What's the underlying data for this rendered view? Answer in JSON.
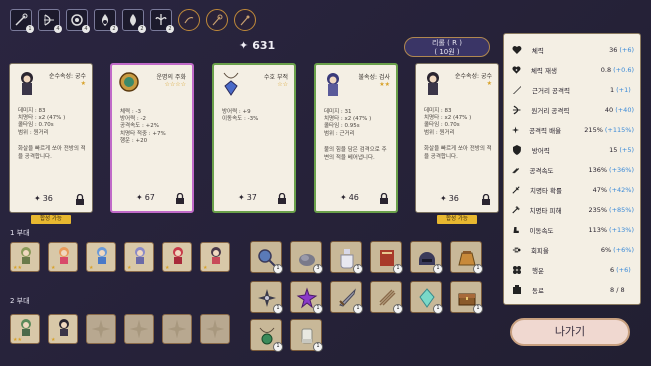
{
  "gold": "631",
  "reroll": {
    "line1": "리롤 ( R )",
    "line2": "( 10원 )"
  },
  "skills": [
    {
      "icon": "wand-icon",
      "lvl": "1"
    },
    {
      "icon": "bow-icon",
      "lvl": "4"
    },
    {
      "icon": "orb-icon",
      "lvl": "4"
    },
    {
      "icon": "fire-icon",
      "lvl": "2"
    },
    {
      "icon": "flame-icon",
      "lvl": "2"
    },
    {
      "icon": "leaf-icon",
      "lvl": "2"
    },
    {
      "icon": "wind-icon",
      "lvl": ""
    },
    {
      "icon": "staff-icon",
      "lvl": ""
    },
    {
      "icon": "rod-icon",
      "lvl": ""
    }
  ],
  "cards": [
    {
      "title": "순수속성: 궁수",
      "stars": "★",
      "stats": "데미지 : 83\n치명타 : x2 (47% )\n쿨타임 : 0.70s\n범위 : 원거리",
      "desc": "화살을 빠르게 쏘아 전방의 적을 공격합니다.",
      "price": "36"
    },
    {
      "title": "운명의 주화",
      "stars": "☆☆☆☆",
      "stats": "체력 : -3\n방어력 : -2\n공격속도 : +2%\n치명타 적중 : +7%\n행운 : +20",
      "desc": "",
      "price": "67"
    },
    {
      "title": "수호 부적",
      "stars": "☆☆",
      "stats": "방어력 : +9\n이동속도 : -3%",
      "desc": "",
      "price": "37"
    },
    {
      "title": "불속성: 검사",
      "stars": "★★",
      "stats": "데미지 : 31\n치명타 : x2 (47% )\n쿨타임 : 0.95s\n범위 : 근거리",
      "desc": "불의 힘을 담은 검격으로 주변의 적을 베어냅니다.",
      "price": "46"
    },
    {
      "title": "순수속성: 궁수",
      "stars": "★",
      "stats": "데미지 : 83\n치명타 : x2 (47% )\n쿨타임 : 0.70s\n범위 : 원거리",
      "desc": "화살을 빠르게 쏘아 전방의 적을 공격합니다.",
      "price": "36"
    }
  ],
  "buy_tag": "합성 가능",
  "party1_label": "1 부대",
  "party2_label": "2 부대",
  "stats": [
    {
      "name": "체력",
      "value": "36",
      "bonus": "(+6)"
    },
    {
      "name": "체력 재생",
      "value": "0.8",
      "bonus": "(+0.6)"
    },
    {
      "name": "근거리 공격력",
      "value": "1",
      "bonus": "(+1)"
    },
    {
      "name": "원거리 공격력",
      "value": "40",
      "bonus": "(+40)"
    },
    {
      "name": "공격력 배율",
      "value": "215%",
      "bonus": "(+115%)"
    },
    {
      "name": "방어력",
      "value": "15",
      "bonus": "(+5)"
    },
    {
      "name": "공격속도",
      "value": "136%",
      "bonus": "(+36%)"
    },
    {
      "name": "치명타 확률",
      "value": "47%",
      "bonus": "(+42%)"
    },
    {
      "name": "치명타 피해",
      "value": "235%",
      "bonus": "(+85%)"
    },
    {
      "name": "이동속도",
      "value": "113%",
      "bonus": "(+13%)"
    },
    {
      "name": "회피율",
      "value": "6%",
      "bonus": "(+6%)"
    },
    {
      "name": "행운",
      "value": "6",
      "bonus": "(+6)"
    },
    {
      "name": "동료",
      "value": "8 / 8",
      "bonus": ""
    }
  ],
  "exit_label": "나가기"
}
